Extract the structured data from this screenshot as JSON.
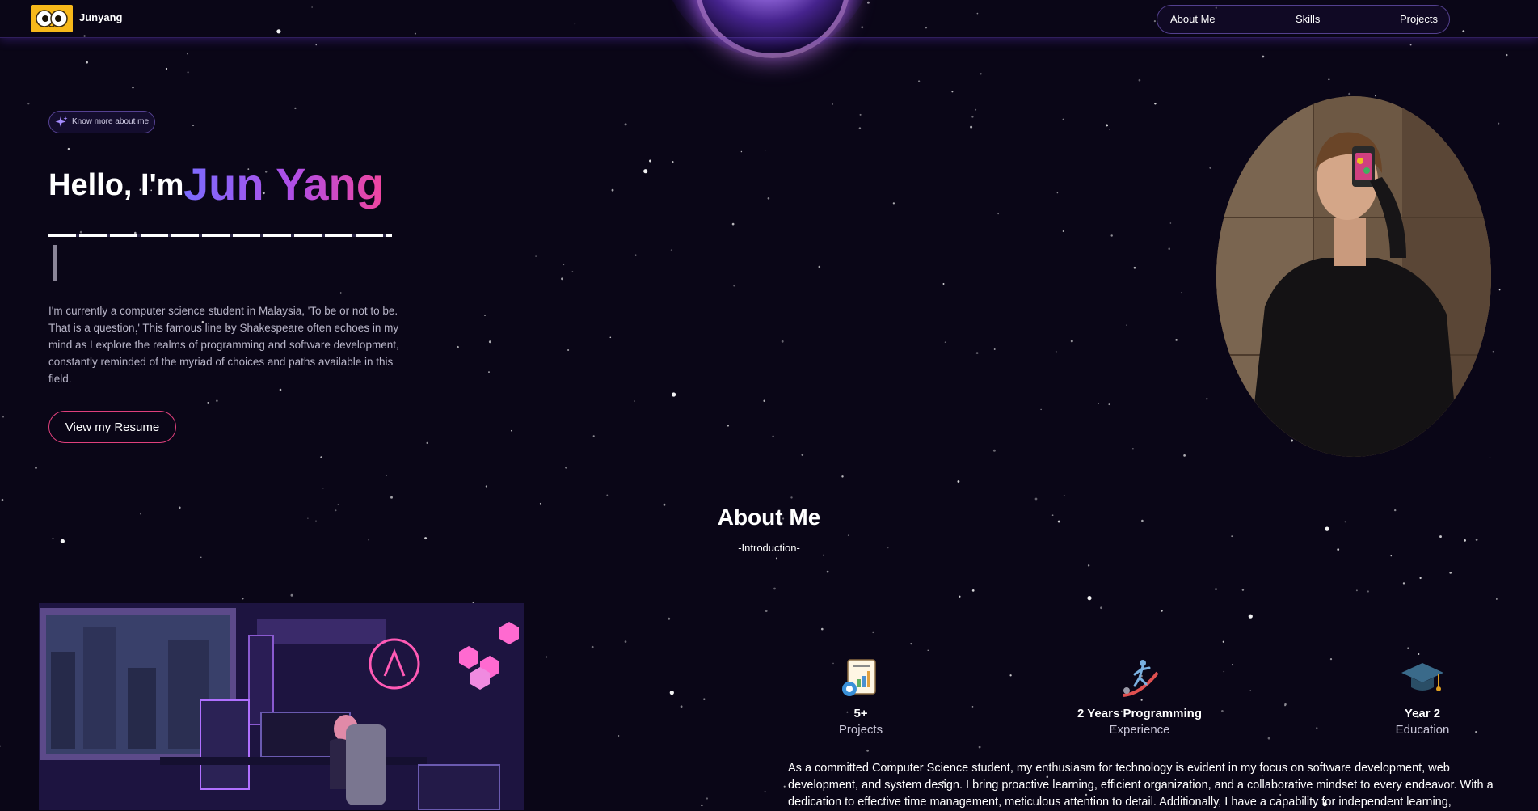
{
  "header": {
    "brand": "Junyang",
    "nav": [
      "About Me",
      "Skills",
      "Projects"
    ]
  },
  "hero": {
    "badge": "Know more about me",
    "greeting": "Hello, I'm",
    "name": "Jun Yang",
    "intro": "I'm currently a computer science student in Malaysia, 'To be or not to be. That is a question.' This famous line by Shakespeare often echoes in my mind as I explore the realms of programming and software development, constantly reminded of the myriad of choices and paths available in this field.",
    "resume_button": "View my Resume"
  },
  "about": {
    "title": "About Me",
    "subtitle": "-Introduction-",
    "stats": [
      {
        "value": "5+",
        "label": "Projects",
        "icon": "report-icon"
      },
      {
        "value": "2 Years Programming",
        "label": "Experience",
        "icon": "climber-icon"
      },
      {
        "value": "Year 2",
        "label": "Education",
        "icon": "graduation-cap-icon"
      }
    ],
    "text": "As a committed Computer Science student, my enthusiasm for technology is evident in my focus on software development, web development, and system design. I bring proactive learning, efficient organization, and a collaborative mindset to every endeavor. With a dedication to effective time management, meticulous attention to detail. Additionally, I have a capability for independent learning,"
  },
  "colors": {
    "background": "#0a0617",
    "accent_gradient": [
      "#7b6cff",
      "#b04ee6",
      "#f0459f"
    ],
    "resume_border": "#e0407c",
    "logo_bg": "#f7b81a"
  }
}
